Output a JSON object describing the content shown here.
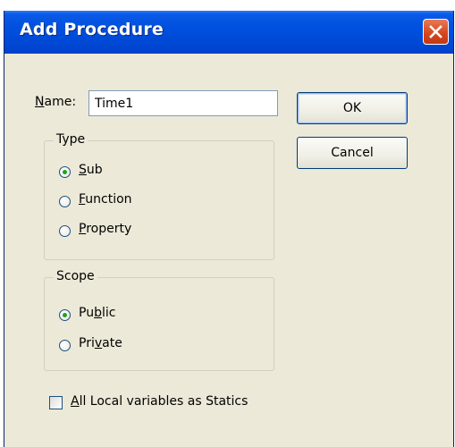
{
  "window": {
    "title": "Add Procedure"
  },
  "name": {
    "label_mnemonic": "N",
    "label_rest": "ame:",
    "value": "Time1"
  },
  "buttons": {
    "ok": "OK",
    "cancel": "Cancel"
  },
  "type_group": {
    "legend": "Type",
    "options": [
      {
        "mnemonic": "S",
        "rest": "ub",
        "selected": true
      },
      {
        "mnemonic": "F",
        "rest": "unction",
        "selected": false
      },
      {
        "mnemonic": "P",
        "rest": "roperty",
        "selected": false
      }
    ]
  },
  "scope_group": {
    "legend": "Scope",
    "options": [
      {
        "pre": "Pu",
        "mnemonic": "b",
        "rest": "lic",
        "selected": true
      },
      {
        "pre": "Pri",
        "mnemonic": "v",
        "rest": "ate",
        "selected": false
      }
    ]
  },
  "statics": {
    "mnemonic": "A",
    "rest": "ll Local variables as Statics",
    "checked": false
  },
  "colors": {
    "title_bar": "#0050df",
    "dialog_bg": "#ece9d8",
    "close_button": "#d6441c"
  }
}
